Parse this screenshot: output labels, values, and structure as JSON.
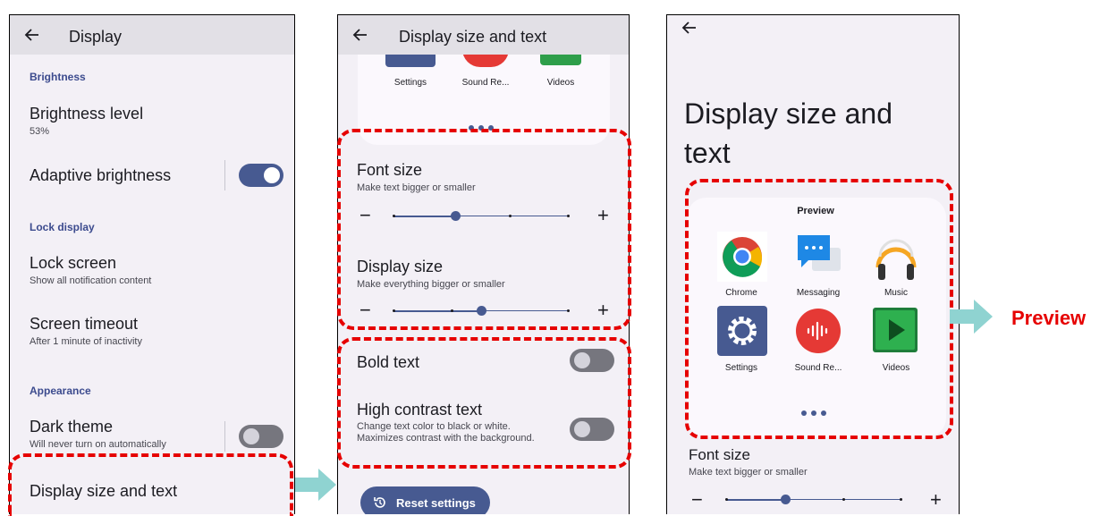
{
  "panel1": {
    "title": "Display",
    "sections": {
      "brightness": "Brightness",
      "lock_display": "Lock display",
      "appearance": "Appearance"
    },
    "items": {
      "brightness_level": {
        "title": "Brightness level",
        "summary": "53%"
      },
      "adaptive_brightness": {
        "title": "Adaptive brightness",
        "toggle": "on"
      },
      "lock_screen": {
        "title": "Lock screen",
        "summary": "Show all notification content"
      },
      "screen_timeout": {
        "title": "Screen timeout",
        "summary": "After 1 minute of inactivity"
      },
      "dark_theme": {
        "title": "Dark theme",
        "summary": "Will never turn on automatically",
        "toggle": "off"
      },
      "display_size_text": {
        "title": "Display size and text"
      }
    }
  },
  "panel2": {
    "title": "Display size and text",
    "preview_apps": [
      "Settings",
      "Sound Re...",
      "Videos"
    ],
    "font_size": {
      "title": "Font size",
      "summary": "Make text bigger or smaller",
      "minus": "−",
      "plus": "+",
      "level": 2,
      "steps": 4
    },
    "display_size": {
      "title": "Display size",
      "summary": "Make everything bigger or smaller",
      "minus": "−",
      "plus": "+",
      "level": 2,
      "steps": 4
    },
    "bold_text": {
      "title": "Bold text",
      "toggle": "off"
    },
    "high_contrast": {
      "title": "High contrast text",
      "summary": "Change text color to black or white. Maximizes contrast with the background.",
      "toggle": "off"
    },
    "reset_button": "Reset settings"
  },
  "panel3": {
    "title": "Display size and text",
    "preview_heading": "Preview",
    "apps": [
      {
        "label": "Chrome",
        "icon": "chrome-icon"
      },
      {
        "label": "Messaging",
        "icon": "messaging-icon"
      },
      {
        "label": "Music",
        "icon": "music-icon"
      },
      {
        "label": "Settings",
        "icon": "settings-icon"
      },
      {
        "label": "Sound Re...",
        "icon": "sound-recorder-icon"
      },
      {
        "label": "Videos",
        "icon": "videos-icon"
      }
    ],
    "font_size": {
      "title": "Font size",
      "summary": "Make text bigger or smaller",
      "minus": "−",
      "plus": "+"
    }
  },
  "annotation": {
    "preview_label": "Preview"
  },
  "colors": {
    "accent": "#475a91",
    "highlight": "#e60000",
    "arrow": "#8fd3d1",
    "background": "#f3f0f6"
  }
}
